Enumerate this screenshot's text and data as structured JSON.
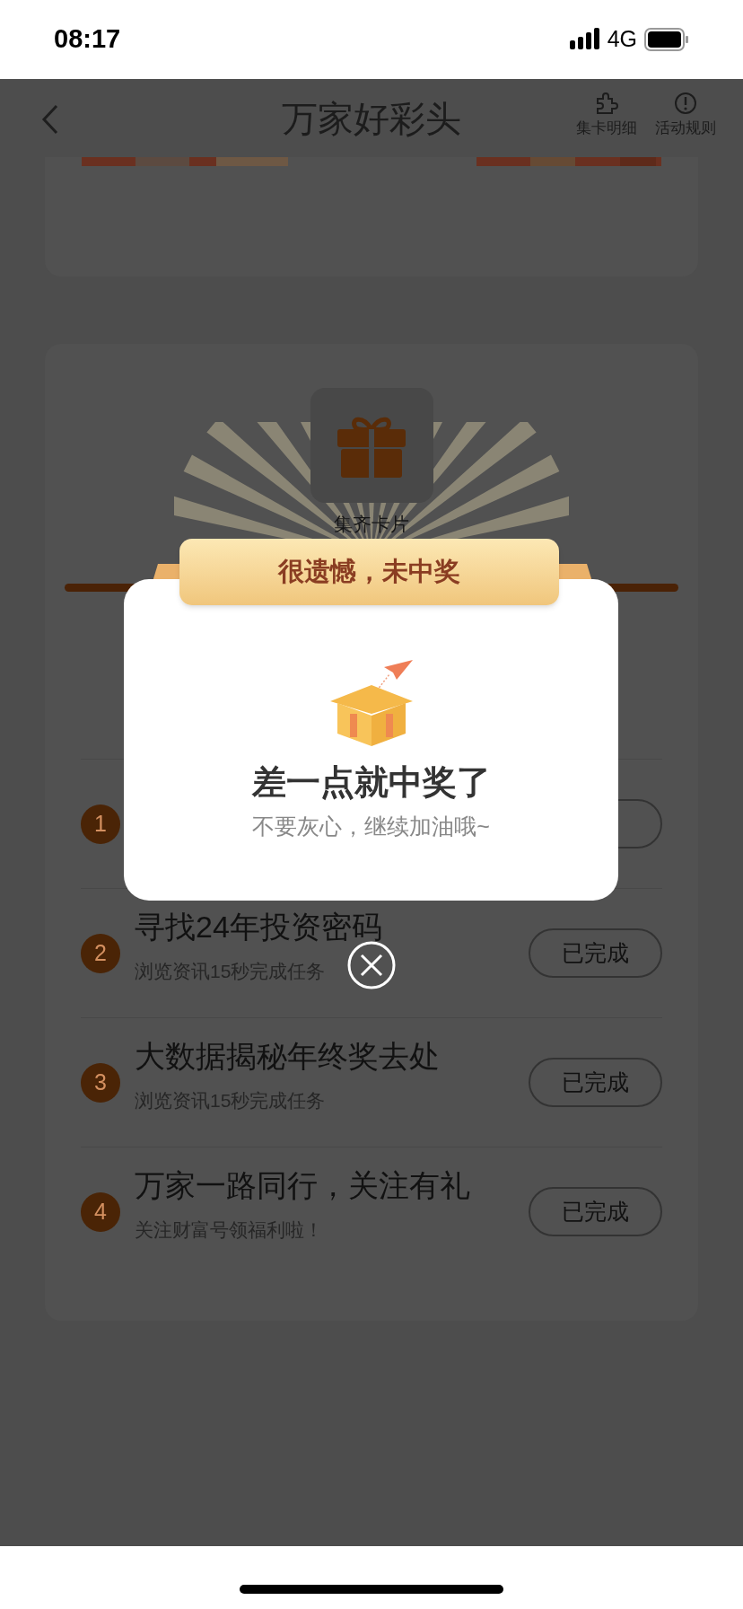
{
  "status_bar": {
    "time": "08:17",
    "network": "4G"
  },
  "header": {
    "title": "万家好彩头",
    "actions": [
      {
        "label": "集卡明细",
        "kind": "puzzle"
      },
      {
        "label": "活动规则",
        "kind": "info"
      }
    ]
  },
  "reward": {
    "label": "集齐卡片"
  },
  "tasks": [
    {
      "number": "1"
    },
    {
      "number": "2",
      "title": "寻找24年投资密码",
      "subtitle": "浏览资讯15秒完成任务",
      "button": "已完成"
    },
    {
      "number": "3",
      "title": "大数据揭秘年终奖去处",
      "subtitle": "浏览资讯15秒完成任务",
      "button": "已完成"
    },
    {
      "number": "4",
      "title": "万家一路同行，关注有礼",
      "subtitle": "关注财富号领福利啦！",
      "button": "已完成"
    }
  ],
  "dialog": {
    "ribbon": "很遗憾，未中奖",
    "title": "差一点就中奖了",
    "message": "不要灰心，继续加油哦~"
  }
}
